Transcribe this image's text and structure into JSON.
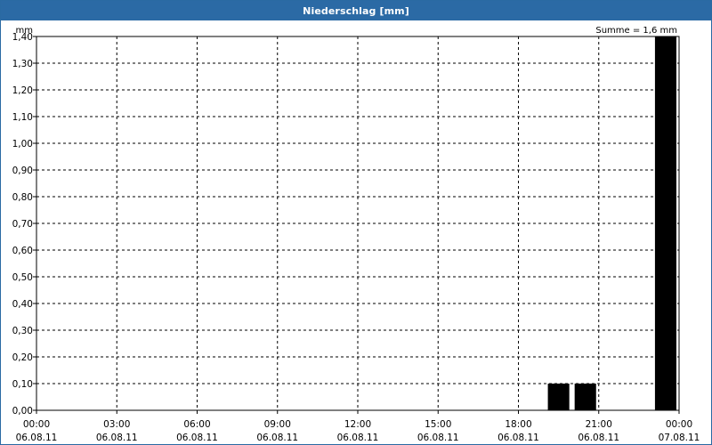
{
  "window": {
    "title": "Niederschlag [mm]",
    "title_bar_color": "#2b6aa5"
  },
  "chart_data": {
    "type": "bar",
    "unit_label": "mm",
    "summary": "Summe = 1,6 mm",
    "bar_color": "#000000",
    "grid": true,
    "ylim": [
      0,
      1.4
    ],
    "y_ticks": [
      0,
      0.1,
      0.2,
      0.3,
      0.4,
      0.5,
      0.6,
      0.7,
      0.8,
      0.9,
      1.0,
      1.1,
      1.2,
      1.3,
      1.4
    ],
    "y_tick_labels": [
      "0,00",
      "0,10",
      "0,20",
      "0,30",
      "0,40",
      "0,50",
      "0,60",
      "0,70",
      "0,80",
      "0,90",
      "1,00",
      "1,10",
      "1,20",
      "1,30",
      "1,40"
    ],
    "x_ticks": [
      {
        "time": "00:00",
        "date": "06.08.11"
      },
      {
        "time": "03:00",
        "date": "06.08.11"
      },
      {
        "time": "06:00",
        "date": "06.08.11"
      },
      {
        "time": "09:00",
        "date": "06.08.11"
      },
      {
        "time": "12:00",
        "date": "06.08.11"
      },
      {
        "time": "15:00",
        "date": "06.08.11"
      },
      {
        "time": "18:00",
        "date": "06.08.11"
      },
      {
        "time": "21:00",
        "date": "06.08.11"
      },
      {
        "time": "00:00",
        "date": "07.08.11"
      }
    ],
    "bars": [
      {
        "start": "06.08.11 19:00",
        "end": "06.08.11 20:00",
        "value": 0.1
      },
      {
        "start": "06.08.11 20:00",
        "end": "06.08.11 21:00",
        "value": 0.1
      },
      {
        "start": "06.08.11 23:00",
        "end": "07.08.11 00:00",
        "value": 1.4
      }
    ]
  }
}
